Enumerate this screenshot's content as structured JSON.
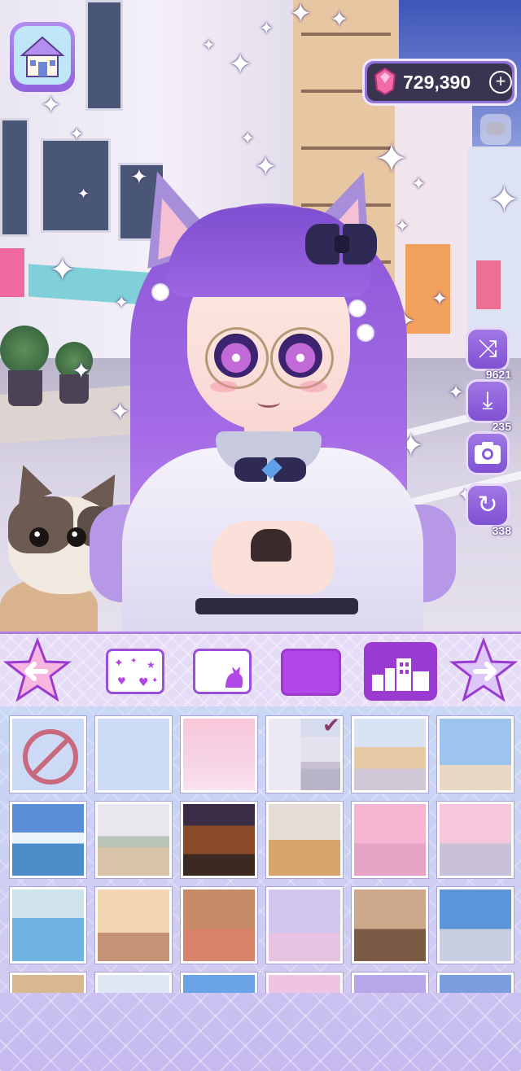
{
  "hud": {
    "home_icon": "house-icon",
    "gems": "729,390",
    "gem_icon": "pink-gem-icon",
    "add_gems_icon": "plus-circle-icon",
    "chat_icon": "chat-bubble-icon"
  },
  "side_buttons": [
    {
      "name": "shuffle",
      "icon": "shuffle-icon",
      "glyph": "⤨",
      "count": "9621"
    },
    {
      "name": "save",
      "icon": "download-icon",
      "glyph": "⤓",
      "count": "235"
    },
    {
      "name": "camera",
      "icon": "camera-icon",
      "glyph": "",
      "count": ""
    },
    {
      "name": "redo",
      "icon": "redo-icon",
      "glyph": "↻",
      "count": "338"
    }
  ],
  "category_tabs": [
    {
      "name": "stickers",
      "icon": "sparkle-stickers-icon",
      "selected": false
    },
    {
      "name": "frame",
      "icon": "cat-frame-icon",
      "selected": false
    },
    {
      "name": "color",
      "icon": "solid-color-icon",
      "selected": false
    },
    {
      "name": "background",
      "icon": "city-background-icon",
      "selected": true
    }
  ],
  "arrows": {
    "prev_icon": "arrow-left-star-icon",
    "next_icon": "arrow-right-star-icon"
  },
  "backgrounds": [
    {
      "name": "none",
      "icon": "no-sign-icon"
    },
    {
      "name": "light-blue"
    },
    {
      "name": "pink-gradient"
    },
    {
      "name": "city-street",
      "selected": true
    },
    {
      "name": "shop-corner"
    },
    {
      "name": "room-window"
    },
    {
      "name": "seaside"
    },
    {
      "name": "classroom"
    },
    {
      "name": "japanese-house"
    },
    {
      "name": "auditorium"
    },
    {
      "name": "cherry-path"
    },
    {
      "name": "cherry-street"
    },
    {
      "name": "pool"
    },
    {
      "name": "classroom-sunset"
    },
    {
      "name": "bedroom"
    },
    {
      "name": "sakura-crossing"
    },
    {
      "name": "cafeteria"
    },
    {
      "name": "rooftop"
    },
    {
      "name": "hallway"
    },
    {
      "name": "greenhouse"
    },
    {
      "name": "sky"
    },
    {
      "name": "pink-field"
    },
    {
      "name": "rainbow"
    },
    {
      "name": "ferris-wheel"
    }
  ],
  "colors": {
    "accent": "#9a3ad0",
    "selected_color": "#b346e6",
    "grid_bg": "#c7d7f4"
  }
}
